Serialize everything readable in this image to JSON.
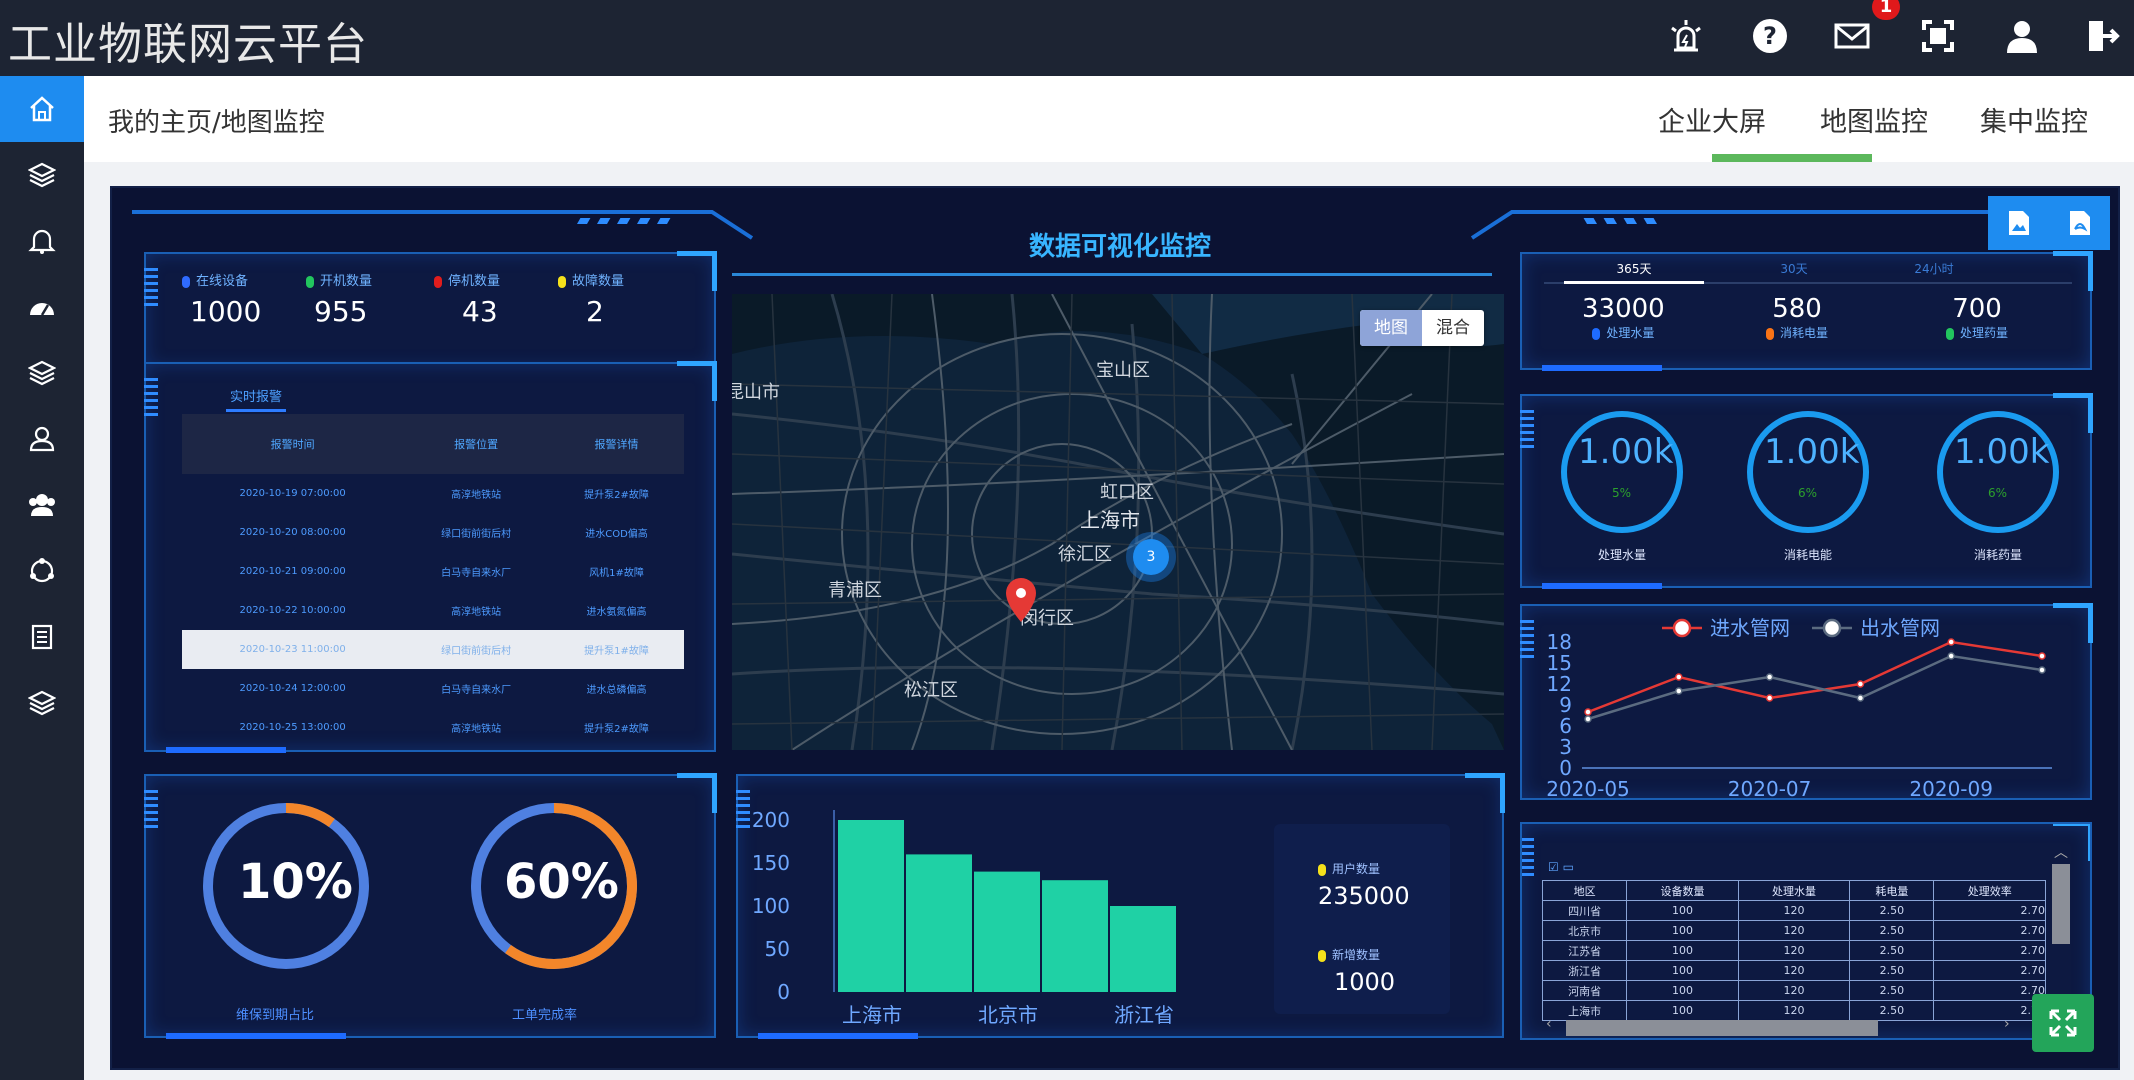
{
  "app": {
    "title": "工业物联网云平台",
    "alert_count": "1"
  },
  "topbar": {
    "icons": [
      "alarm-light-icon",
      "help-icon",
      "mail-icon",
      "fullscreen-icon",
      "user-icon",
      "logout-icon"
    ]
  },
  "sidebar": {
    "items": [
      "home-icon",
      "layers-icon",
      "bell-icon",
      "dashboard-icon",
      "stack-icon",
      "user-profile-icon",
      "users-icon",
      "share-icon",
      "report-icon",
      "stack-icon-2"
    ]
  },
  "nav": {
    "breadcrumb": "我的主页/地图监控",
    "tabs": [
      "企业大屏",
      "地图监控",
      "集中监控"
    ],
    "active_tab": "企业大屏"
  },
  "dashboard": {
    "title": "数据可视化监控",
    "device_stats": [
      {
        "label": "在线设备",
        "value": "1000",
        "color": "#2f6bff"
      },
      {
        "label": "开机数量",
        "value": "955",
        "color": "#22c55e"
      },
      {
        "label": "停机数量",
        "value": "43",
        "color": "#e11d1d"
      },
      {
        "label": "故障数量",
        "value": "2",
        "color": "#f5e11b"
      }
    ],
    "alarm": {
      "tab": "实时报警",
      "headers": [
        "报警时间",
        "报警位置",
        "报警详情"
      ],
      "rows": [
        [
          "2020-10-19 07:00:00",
          "高淳地铁站",
          "提升泵2#故障"
        ],
        [
          "2020-10-20 08:00:00",
          "绿口街前街后村",
          "进水COD偏高"
        ],
        [
          "2020-10-21 09:00:00",
          "白马寺自来水厂",
          "风机1#故障"
        ],
        [
          "2020-10-22 10:00:00",
          "高淳地铁站",
          "进水氨氮偏高"
        ],
        [
          "2020-10-23 11:00:00",
          "绿口街前街后村",
          "提升泵1#故障"
        ],
        [
          "2020-10-24 12:00:00",
          "白马寺自来水厂",
          "进水总磷偏高"
        ],
        [
          "2020-10-25 13:00:00",
          "高淳地铁站",
          "提升泵2#故障"
        ]
      ],
      "selected_row": 4
    },
    "map": {
      "toggle": [
        "地图",
        "混合"
      ],
      "labels": [
        "宝山区",
        "昆山市",
        "虹口区",
        "上海市",
        "徐汇区",
        "青浦区",
        "闵行区",
        "松江区"
      ],
      "cluster_count": "3"
    },
    "period_tabs": [
      "365天",
      "30天",
      "24小时"
    ],
    "period_stats": [
      {
        "value": "33000",
        "label": "处理水量",
        "color": "#1e6bff"
      },
      {
        "value": "580",
        "label": "消耗电量",
        "color": "#f97316"
      },
      {
        "value": "700",
        "label": "处理药量",
        "color": "#22c55e"
      }
    ],
    "gauges": [
      {
        "value": "1.00k",
        "pct": "5%",
        "label": "处理水量"
      },
      {
        "value": "1.00k",
        "pct": "6%",
        "label": "消耗电能"
      },
      {
        "value": "1.00k",
        "pct": "6%",
        "label": "消耗药量"
      }
    ],
    "rings": [
      {
        "value": "10%",
        "label": "维保到期占比",
        "fraction": 0.1,
        "color": "#f3862a",
        "track": "#4f80e1"
      },
      {
        "value": "60%",
        "label": "工单完成率",
        "fraction": 0.6,
        "color": "#f3862a",
        "track": "#4f80e1"
      }
    ],
    "users": [
      {
        "label": "用户数量",
        "value": "235000"
      },
      {
        "label": "新增数量",
        "value": "1000"
      }
    ],
    "region_table": {
      "caption": "☑ ▭",
      "headers": [
        "地区",
        "设备数量",
        "处理水量",
        "耗电量",
        "处理效率"
      ],
      "rows": [
        [
          "四川省",
          "100",
          "120",
          "2.50",
          "2.70"
        ],
        [
          "北京市",
          "100",
          "120",
          "2.50",
          "2.70"
        ],
        [
          "江苏省",
          "100",
          "120",
          "2.50",
          "2.70"
        ],
        [
          "浙江省",
          "100",
          "120",
          "2.50",
          "2.70"
        ],
        [
          "河南省",
          "100",
          "120",
          "2.50",
          "2.70"
        ],
        [
          "上海市",
          "100",
          "120",
          "2.50",
          "2.70"
        ]
      ]
    }
  },
  "chart_data": [
    {
      "type": "bar",
      "categories": [
        "上海市",
        "",
        "北京市",
        "",
        "浙江省"
      ],
      "tick_labels": [
        "上海市",
        "北京市",
        "浙江省"
      ],
      "values": [
        200,
        160,
        140,
        130,
        100
      ],
      "yticks": [
        "200",
        "150",
        "100",
        "50",
        "0"
      ],
      "ylim": [
        0,
        200
      ],
      "color": "#1fd1a5"
    },
    {
      "type": "line",
      "x_ticks": [
        "2020-05",
        "2020-07",
        "2020-09"
      ],
      "y_ticks": [
        "18",
        "15",
        "12",
        "9",
        "6",
        "3",
        "0"
      ],
      "ylim": [
        0,
        18
      ],
      "series": [
        {
          "name": "进水管网",
          "values": [
            8,
            13,
            10,
            12,
            18,
            16
          ],
          "color": "#e53935"
        },
        {
          "name": "出水管网",
          "values": [
            7,
            11,
            13,
            10,
            16,
            14
          ],
          "color": "#5b6b80"
        }
      ]
    }
  ]
}
